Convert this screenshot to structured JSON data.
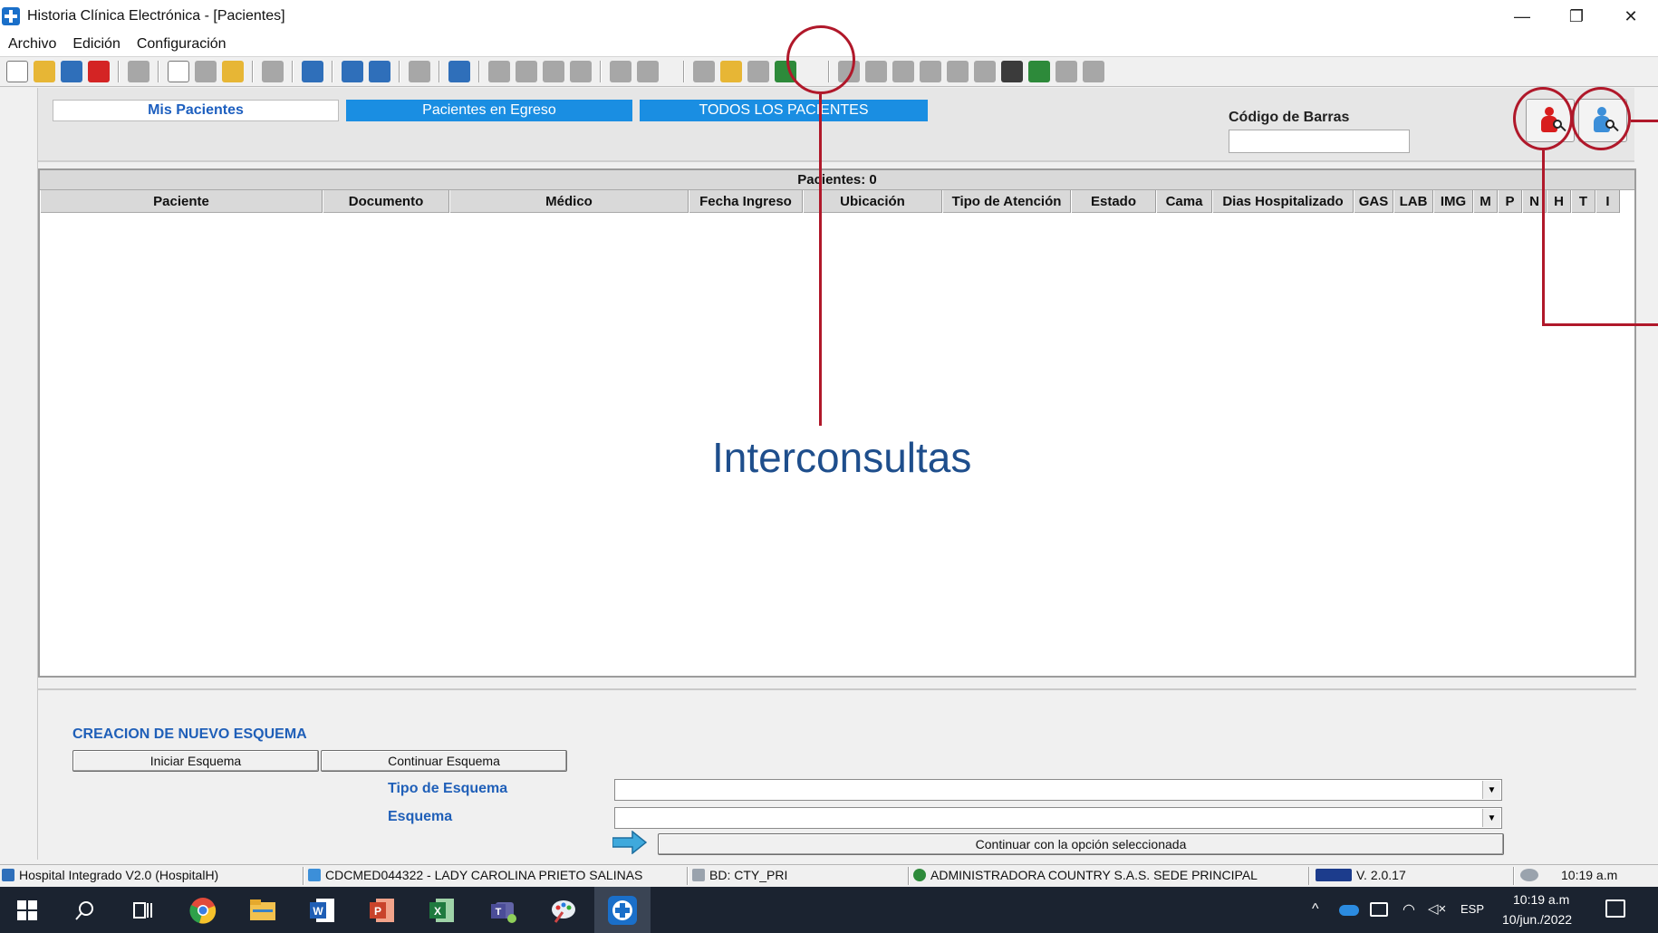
{
  "window": {
    "title": "Historia Clínica Electrónica - [Pacientes]",
    "controls": [
      "—",
      "❐",
      "✕"
    ]
  },
  "menu": [
    "Archivo",
    "Edición",
    "Configuración"
  ],
  "tabs": [
    "Mis Pacientes",
    "Pacientes en Egreso",
    "TODOS LOS PACIENTES"
  ],
  "barcode": {
    "label": "Código de Barras",
    "value": ""
  },
  "table": {
    "count_label": "Pacientes: 0",
    "columns": [
      "Paciente",
      "Documento",
      "Médico",
      "Fecha Ingreso",
      "Ubicación",
      "Tipo de Atención",
      "Estado",
      "Cama",
      "Dias Hospitalizado",
      "GAS",
      "LAB",
      "IMG",
      "M",
      "P",
      "N",
      "H",
      "T",
      "I"
    ],
    "rows": []
  },
  "annotation": {
    "text": "Interconsultas",
    "color": "#b0182a"
  },
  "schema": {
    "title": "CREACION DE NUEVO ESQUEMA",
    "btn_start": "Iniciar Esquema",
    "btn_continue": "Continuar Esquema",
    "tipo_label": "Tipo de Esquema",
    "tipo_value": "",
    "esquema_label": "Esquema",
    "esquema_value": "",
    "continue_option": "Continuar con la opción seleccionada"
  },
  "status": {
    "app": "Hospital Integrado V2.0 (HospitalH)",
    "user": "CDCMED044322 - LADY CAROLINA PRIETO SALINAS",
    "db": "BD: CTY_PRI",
    "org": "ADMINISTRADORA COUNTRY S.A.S.  SEDE PRINCIPAL",
    "version": "V. 2.0.17",
    "time": "10:19 a.m"
  },
  "taskbar": {
    "lang": "ESP",
    "time": "10:19 a.m",
    "date": "10/jun./2022"
  },
  "colors": {
    "accent_blue": "#1a8ee2",
    "label_blue": "#1f5fb8",
    "annotation_red": "#b0182a"
  }
}
